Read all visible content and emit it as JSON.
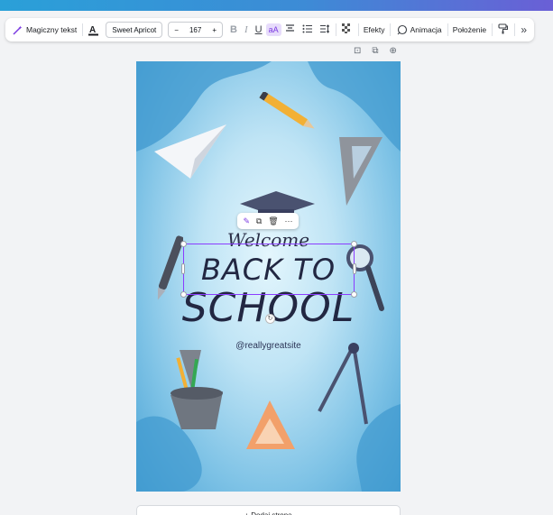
{
  "toolbar": {
    "magic_text_label": "Magiczny tekst",
    "font_name": "Sweet Apricot",
    "font_size": "167",
    "minus": "−",
    "plus": "+",
    "bold": "B",
    "italic": "I",
    "underline": "U",
    "case": "aA",
    "effects_label": "Efekty",
    "animation_label": "Animacja",
    "position_label": "Położenie",
    "more": "»"
  },
  "page_actions": {
    "lock": "⊡",
    "duplicate": "⧉",
    "add": "⊕"
  },
  "context_menu": {
    "more": "···"
  },
  "design": {
    "welcome": "Welcome",
    "line1": "BACK TO",
    "line2": "SCHOOL",
    "handle": "@reallygreatsite"
  },
  "add_page_label": "+ Dodaj stronę",
  "colors": {
    "accent": "#8b3dff",
    "stripe_start": "#2aa0d8",
    "stripe_end": "#6a5fd6"
  }
}
